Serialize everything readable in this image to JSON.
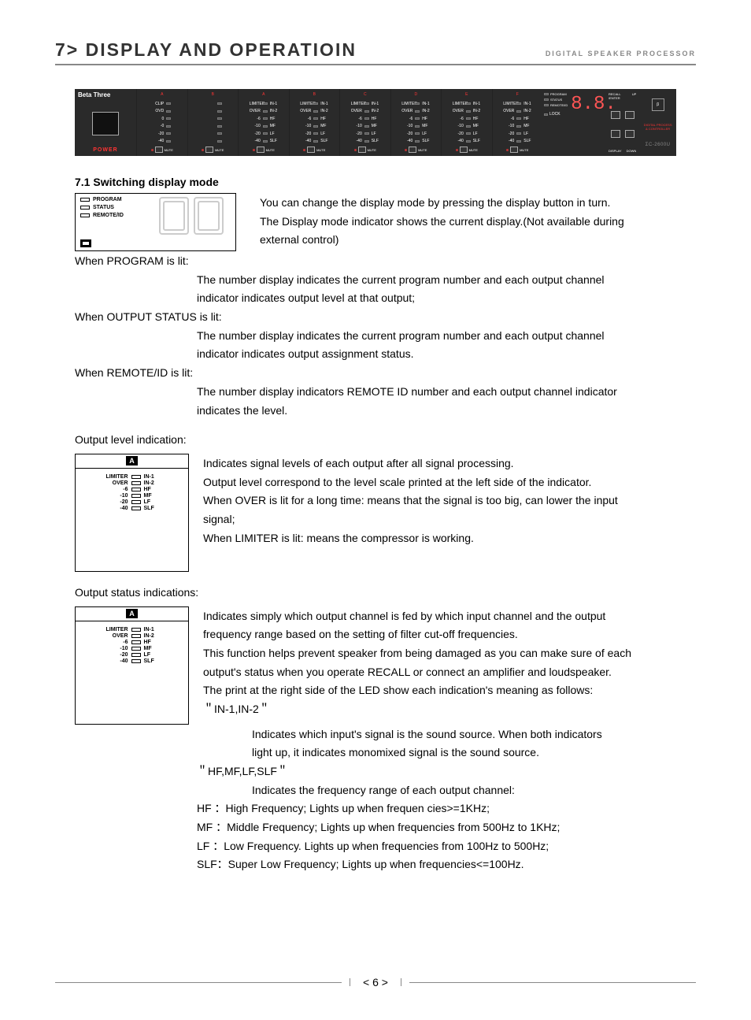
{
  "header": {
    "title": "7> DISPLAY AND OPERATIOIN",
    "subtitle": "DIGITAL SPEAKER PROCESSOR"
  },
  "panel": {
    "brand": "Beta Three",
    "power": "POWER",
    "input_cols": [
      "A",
      "B"
    ],
    "input_leds_left": [
      "CLIP",
      "OVD",
      "0",
      "-0",
      "-20",
      "-40"
    ],
    "output_cols": [
      "A",
      "B",
      "C",
      "D",
      "E",
      "F"
    ],
    "output_leds_left": [
      "LIMITER",
      "OVER",
      "-6",
      "-10",
      "-20",
      "-40"
    ],
    "output_leds_right": [
      "IN-1",
      "IN-2",
      "HF",
      "MF",
      "LF",
      "SLF"
    ],
    "mute": "MUTE",
    "disp_lines": [
      "PROGRAM",
      "STATUS",
      "REMOTE/ID"
    ],
    "lock": "LOCK",
    "digits": "8.8.",
    "btn_top": [
      "RECALL /ENTER",
      "UP"
    ],
    "btn_bot": [
      "DISPLAY",
      "DOWN"
    ],
    "logo_red": "DIGITAL PROCESS & CONTROLLER",
    "model": "ΣC-2600U"
  },
  "section": {
    "s71": "7.1 Switching display mode"
  },
  "mode_box": {
    "lines": [
      "PROGRAM",
      "STATUS",
      "REMOTE/ID"
    ]
  },
  "text": {
    "intro1": "You can change the display mode by pressing the display button in turn.",
    "intro2": "The Display mode indicator shows the current display.(Not available during",
    "intro3": "external control)",
    "prog_lbl": "When PROGRAM is lit:",
    "prog_l1": "The number display indicates the current program number and each output channel",
    "prog_l2": "indicator indicates output level at that output;",
    "stat_lbl": "When OUTPUT STATUS is lit:",
    "stat_l1": "The number display indicates the current program number and each output channel",
    "stat_l2": "indicator indicates output assignment status.",
    "rem_lbl": "When REMOTE/ID is lit:",
    "rem_l1": "The number display indicators REMOTE ID number and each output channel indicator",
    "rem_l2": "indicates the level.",
    "out_lvl_lbl": "Output level indication:",
    "ol1": "Indicates signal levels of each output after all signal processing.",
    "ol2": "Output level correspond to the level scale printed at the left side of the indicator.",
    "ol3": "When OVER is lit for a long time: means that the signal is too big,  can lower the input",
    "ol4": "signal;",
    "ol5": "When LIMITER is lit:  means the compressor is working.",
    "out_stat_lbl": "Output status indications:",
    "os1": "Indicates simply which output channel is fed by which input channel and the output",
    "os2": "frequency range based on the setting of filter cut-off frequencies.",
    "os3": "This function helps prevent speaker from being damaged as you can make sure of each",
    "os4": "output's status when you operate RECALL or connect an amplifier and loudspeaker.",
    "os5": "The print at the right side of the LED show each indication's meaning as follows:",
    "os6": "＂IN-1,IN-2＂",
    "os7": "Indicates which input's signal is the sound source. When both indicators",
    "os8": "light up, it indicates monomixed signal is the sound source.",
    "os9": "＂HF,MF,LF,SLF＂",
    "os10": "Indicates the frequency range of each output channel:",
    "os11": "HF  ：High Frequency;  Lights up  when frequen cies>=1KHz;",
    "os12": "MF ：Middle Frequency; Lights up when frequencies from 500Hz to 1KHz;",
    "os13": "LF  ：Low Frequency. Lights up when frequencies from 100Hz to 500Hz;",
    "os14": "SLF：Super Low Frequency; Lights up when frequencies<=100Hz."
  },
  "level_box": {
    "tag": "A",
    "rows_l": [
      "LIMITER",
      "OVER",
      "-6",
      "-10",
      "-20",
      "-40"
    ],
    "rows_r": [
      "IN-1",
      "IN-2",
      "HF",
      "MF",
      "LF",
      "SLF"
    ]
  },
  "footer": {
    "page": "6"
  }
}
